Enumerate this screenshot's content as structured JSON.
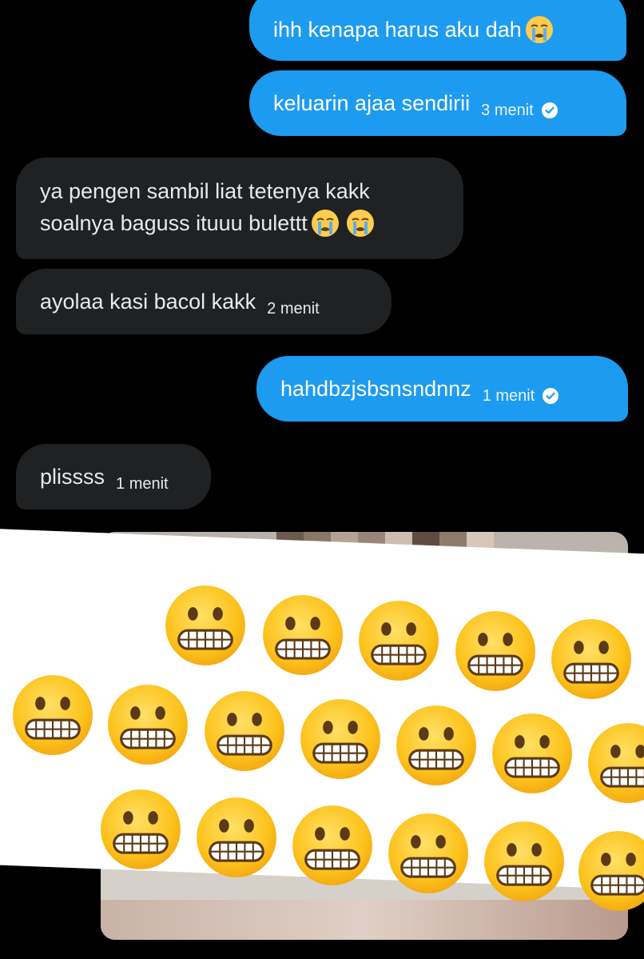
{
  "messages": [
    {
      "side": "out",
      "text": "ihh kenapa harus aku dah",
      "emoji": [
        "loudly-crying-face"
      ]
    },
    {
      "side": "out",
      "text": "keluarin ajaa sendirii",
      "time": "3 menit",
      "read": true
    },
    {
      "side": "in",
      "lines": [
        "ya pengen sambil liat tetenya kakk",
        "soalnya baguss ituuu bulettt"
      ],
      "emoji": [
        "loudly-crying-face",
        "loudly-crying-face"
      ]
    },
    {
      "side": "in",
      "text": "ayolaa kasi bacol kakk",
      "time": "2 menit"
    },
    {
      "side": "out",
      "text": "hahdbzjsbsnsndnnz",
      "time": "1 menit",
      "read": true
    },
    {
      "side": "in",
      "text": "plissss",
      "time": "1 menit"
    }
  ],
  "media": {
    "type": "image",
    "overlay_sticker": "grimacing-face",
    "sticker_count": 18
  },
  "colors": {
    "background": "#000000",
    "outgoing_bubble": "#1d9bf0",
    "incoming_bubble": "#1f2123",
    "text_light": "#e7e9ea"
  }
}
